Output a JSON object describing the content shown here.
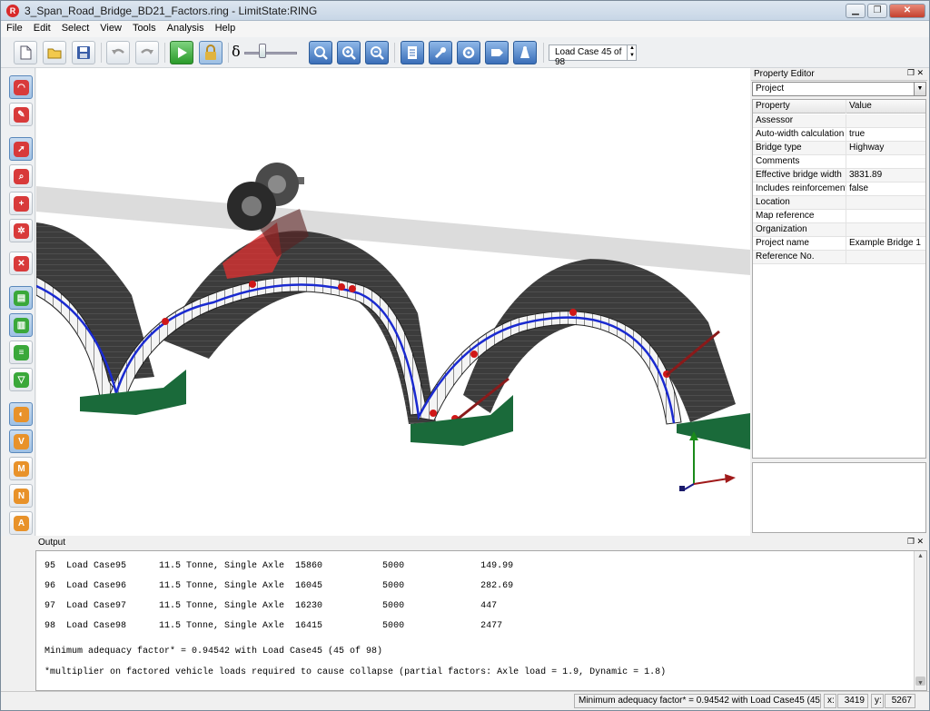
{
  "window": {
    "title": "3_Span_Road_Bridge_BD21_Factors.ring - LimitState:RING",
    "app_icon_letter": "R"
  },
  "menu": [
    "File",
    "Edit",
    "Select",
    "View",
    "Tools",
    "Analysis",
    "Help"
  ],
  "toolbar": {
    "icons": [
      "new-file-icon",
      "open-folder-icon",
      "save-icon",
      "undo-icon",
      "redo-icon",
      "run-analysis-icon",
      "lock-icon",
      "zoom-icon",
      "zoom-in-icon",
      "zoom-out-icon",
      "report-icon",
      "tools-icon",
      "settings-icon",
      "tag-icon",
      "load-icon"
    ],
    "delta_symbol": "δ",
    "load_case_value": "Load Case 45 of 98"
  },
  "left_tools": {
    "icons": [
      "arch-select-icon",
      "arch-edit-icon",
      "element-select-icon",
      "zoom-element-icon",
      "add-element-icon",
      "settings-element-icon",
      "delete-element-icon",
      "visibility-fill-icon",
      "visibility-backing-icon",
      "visibility-list-icon",
      "visibility-load-icon",
      "show-view-icon",
      "hide-view-icon",
      "m-view-icon",
      "n-view-icon",
      "a-view-icon"
    ]
  },
  "property_editor": {
    "title": "Property Editor",
    "selection": "Project",
    "headers": {
      "property": "Property",
      "value": "Value"
    },
    "rows": [
      {
        "property": "Assessor",
        "value": ""
      },
      {
        "property": "Auto-width calculation",
        "value": "true"
      },
      {
        "property": "Bridge type",
        "value": "Highway"
      },
      {
        "property": "Comments",
        "value": ""
      },
      {
        "property": "Effective bridge width",
        "value": "3831.89"
      },
      {
        "property": "Includes reinforcement",
        "value": "false"
      },
      {
        "property": "Location",
        "value": ""
      },
      {
        "property": "Map reference",
        "value": ""
      },
      {
        "property": "Organization",
        "value": ""
      },
      {
        "property": "Project name",
        "value": "Example Bridge 1"
      },
      {
        "property": "Reference No.",
        "value": ""
      }
    ]
  },
  "output": {
    "title": "Output",
    "lines": [
      "95  Load Case95      11.5 Tonne, Single Axle  15860           5000              149.99",
      "96  Load Case96      11.5 Tonne, Single Axle  16045           5000              282.69",
      "97  Load Case97      11.5 Tonne, Single Axle  16230           5000              447",
      "98  Load Case98      11.5 Tonne, Single Axle  16415           5000              2477",
      "Minimum adequacy factor* = 0.94542 with Load Case45 (45 of 98)",
      "*multiplier on factored vehicle loads required to cause collapse (partial factors: Axle load = 1.9, Dynamic = 1.8)"
    ]
  },
  "status": {
    "message": "Minimum adequacy factor* = 0.94542 with Load Case45 (45 of 98)",
    "x_label": "x:",
    "x_value": "3419",
    "y_label": "y:",
    "y_value": "5267"
  },
  "colors": {
    "arch_dark": "#3a3a3a",
    "thrust_line": "#1a2ad0",
    "hinge": "#d01818",
    "support": "#1a6a3a",
    "load_patch": "#e03030"
  }
}
